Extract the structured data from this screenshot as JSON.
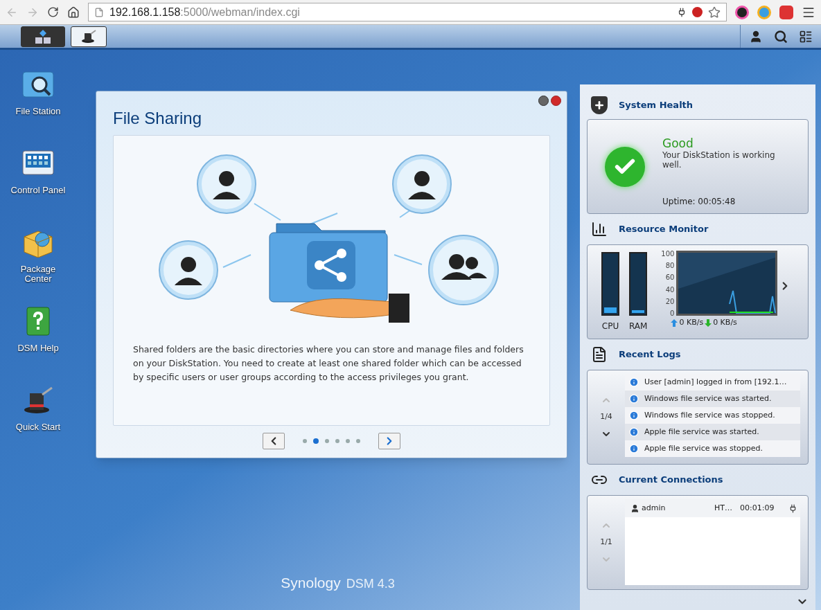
{
  "browser": {
    "url_host": "192.168.1.158",
    "url_rest": ":5000/webman/index.cgi"
  },
  "desktop_icons": [
    {
      "kind": "file-station",
      "label": "File Station"
    },
    {
      "kind": "control-panel",
      "label": "Control Panel"
    },
    {
      "kind": "package-center",
      "label": "Package\nCenter"
    },
    {
      "kind": "help",
      "label": "DSM Help"
    },
    {
      "kind": "quick-start",
      "label": "Quick Start"
    }
  ],
  "taskbar": {
    "buttons": [
      {
        "kind": "main-menu",
        "selected": true
      },
      {
        "kind": "quick-start",
        "selected": false
      }
    ]
  },
  "dialog": {
    "title": "File Sharing",
    "description": "Shared folders are the basic directories where you can store and manage files and folders on your DiskStation. You need to create at least one shared folder which can be accessed by specific users or user groups according to the access privileges you grant.",
    "pages": [
      {
        "selected": false
      },
      {
        "selected": true
      },
      {
        "selected": false
      },
      {
        "selected": false
      },
      {
        "selected": false
      },
      {
        "selected": false
      }
    ]
  },
  "branding": {
    "logo": "Synology",
    "version": "DSM 4.3"
  },
  "widgets": {
    "system_health": {
      "title": "System Health",
      "status": "Good",
      "message": "Your DiskStation is working well.",
      "uptime": "Uptime: 00:05:48"
    },
    "resource_monitor": {
      "title": "Resource Monitor",
      "meters": [
        {
          "label": "CPU",
          "level": 0.1
        },
        {
          "label": "RAM",
          "level": 0.05
        }
      ],
      "upload": "0 KB/s",
      "download": "0 KB/s",
      "scale_labels": [
        "100",
        "80",
        "60",
        "40",
        "20",
        "0"
      ]
    },
    "recent_logs": {
      "title": "Recent Logs",
      "page": "1/4",
      "entries": [
        "User [admin] logged in from [192.1…",
        "Windows file service was started.",
        "Windows file service was stopped.",
        "Apple file service was started.",
        "Apple file service was stopped."
      ]
    },
    "current_connections": {
      "title": "Current Connections",
      "page": "1/1",
      "rows": [
        {
          "user": "admin",
          "protocol": "HT…",
          "time": "00:01:09"
        }
      ]
    }
  }
}
